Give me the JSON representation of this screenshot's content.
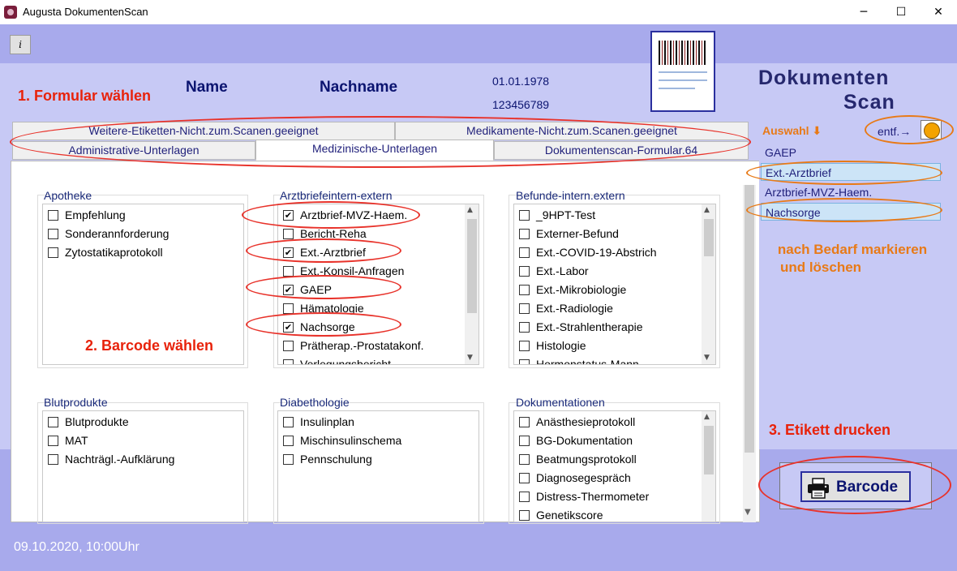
{
  "window": {
    "title": "Augusta DokumentenScan",
    "minimize_glyph": "─",
    "maximize_glyph": "☐",
    "close_glyph": "✕"
  },
  "toolbar": {
    "info_glyph": "i"
  },
  "annotations": {
    "step1": "1.  Formular wählen",
    "step2": "2.  Barcode wählen",
    "step3": "3.  Etikett drucken",
    "hint_line1": "nach  Bedarf markieren",
    "hint_line2": "und löschen"
  },
  "patient": {
    "name_label": "Name",
    "nachname_label": "Nachname",
    "dob": "01.01.1978",
    "id": "123456789"
  },
  "logo": {
    "line1": "Dokumenten",
    "line2": "Scan"
  },
  "tabs": {
    "row1": [
      "Weitere-Etiketten-Nicht.zum.Scanen.geeignet",
      "Medikamente-Nicht.zum.Scanen.geeignet"
    ],
    "row2": [
      "Administrative-Unterlagen",
      "Medizinische-Unterlagen",
      "Dokumentenscan-Formular.64"
    ]
  },
  "groups": [
    {
      "title": "Apotheke",
      "items": [
        {
          "label": "Empfehlung",
          "checked": false
        },
        {
          "label": "Sonderannforderung",
          "checked": false
        },
        {
          "label": "Zytostatikaprotokoll",
          "checked": false
        }
      ]
    },
    {
      "title": "Arztbriefeintern-extern",
      "items": [
        {
          "label": "Arztbrief-MVZ-Haem.",
          "checked": true
        },
        {
          "label": "Bericht-Reha",
          "checked": false
        },
        {
          "label": "Ext.-Arztbrief",
          "checked": true
        },
        {
          "label": "Ext.-Konsil-Anfragen",
          "checked": false
        },
        {
          "label": "GAEP",
          "checked": true
        },
        {
          "label": "Hämatologie",
          "checked": false
        },
        {
          "label": "Nachsorge",
          "checked": true
        },
        {
          "label": "Prätherap.-Prostatakonf.",
          "checked": false
        },
        {
          "label": "Verlegungsbericht",
          "checked": false
        }
      ]
    },
    {
      "title": "Befunde-intern.extern",
      "items": [
        {
          "label": "_9HPT-Test",
          "checked": false
        },
        {
          "label": "Externer-Befund",
          "checked": false
        },
        {
          "label": "Ext.-COVID-19-Abstrich",
          "checked": false
        },
        {
          "label": "Ext.-Labor",
          "checked": false
        },
        {
          "label": "Ext.-Mikrobiologie",
          "checked": false
        },
        {
          "label": "Ext.-Radiologie",
          "checked": false
        },
        {
          "label": "Ext.-Strahlentherapie",
          "checked": false
        },
        {
          "label": "Histologie",
          "checked": false
        },
        {
          "label": "Hormonstatus-Mann",
          "checked": false
        }
      ]
    },
    {
      "title": "Blutprodukte",
      "items": [
        {
          "label": "Blutprodukte",
          "checked": false
        },
        {
          "label": "MAT",
          "checked": false
        },
        {
          "label": "Nachträgl.-Aufklärung",
          "checked": false
        }
      ]
    },
    {
      "title": "Diabethologie",
      "items": [
        {
          "label": "Insulinplan",
          "checked": false
        },
        {
          "label": "Mischinsulinschema",
          "checked": false
        },
        {
          "label": "Pennschulung",
          "checked": false
        }
      ]
    },
    {
      "title": "Dokumentationen",
      "items": [
        {
          "label": "Anästhesieprotokoll",
          "checked": false
        },
        {
          "label": "BG-Dokumentation",
          "checked": false
        },
        {
          "label": "Beatmungsprotokoll",
          "checked": false
        },
        {
          "label": "Diagnosegespräch",
          "checked": false
        },
        {
          "label": "Distress-Thermometer",
          "checked": false
        },
        {
          "label": "Genetikscore",
          "checked": false
        }
      ]
    }
  ],
  "selection": {
    "title": "Auswahl ⬇",
    "remove_label": "entf.→",
    "items": [
      {
        "label": "GAEP",
        "highlighted": false
      },
      {
        "label": "Ext.-Arztbrief",
        "highlighted": true
      },
      {
        "label": "Arztbrief-MVZ-Haem.",
        "highlighted": false
      },
      {
        "label": "Nachsorge",
        "highlighted": true
      }
    ]
  },
  "print_button": {
    "label": "Barcode"
  },
  "status": {
    "datetime": "09.10.2020, 10:00Uhr"
  },
  "colors": {
    "annotation_red": "#e8220a",
    "annotation_orange": "#e87a17",
    "header_text": "#0b1470",
    "background": "#c7c9f5"
  }
}
